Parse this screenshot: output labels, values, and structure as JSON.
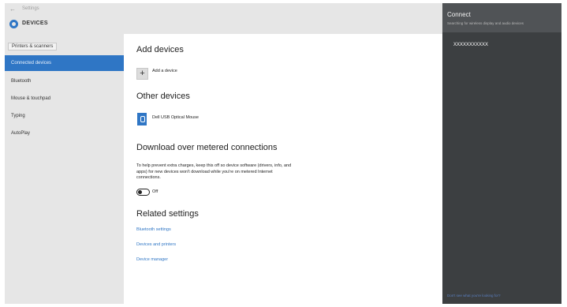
{
  "window": {
    "back_icon": "arrow-left-icon",
    "settings_label": "Settings",
    "section_title": "DEVICES",
    "section_icon": "gear-icon"
  },
  "sidebar": {
    "items": [
      {
        "label": "Printers & scanners",
        "active": false
      },
      {
        "label": "Connected devices",
        "active": true
      },
      {
        "label": "Bluetooth",
        "active": false
      },
      {
        "label": "Mouse & touchpad",
        "active": false
      },
      {
        "label": "Typing",
        "active": false
      },
      {
        "label": "AutoPlay",
        "active": false
      }
    ]
  },
  "main": {
    "add_devices": {
      "heading": "Add devices",
      "button_label": "Add a device",
      "button_icon": "plus-icon"
    },
    "other_devices": {
      "heading": "Other devices",
      "device_name": "Dell USB Optical Mouse",
      "device_icon": "mouse-icon"
    },
    "metered": {
      "heading": "Download over metered connections",
      "description": "To help prevent extra charges, keep this off so device software (drivers, info, and apps) for new devices won't download while you're on metered Internet connections.",
      "toggle_state": "Off"
    },
    "related": {
      "heading": "Related settings",
      "links": [
        "Bluetooth settings",
        "Devices and printers",
        "Device manager"
      ]
    }
  },
  "connect_panel": {
    "title": "Connect",
    "subtitle": "Searching for wireless display and audio devices",
    "device": "XXXXXXXXXXX",
    "footer": "Don't see what you're looking for?"
  },
  "colors": {
    "accent": "#2f76c5",
    "sidebar_bg": "#e6e6e6",
    "panel_bg": "#3c3f41"
  }
}
